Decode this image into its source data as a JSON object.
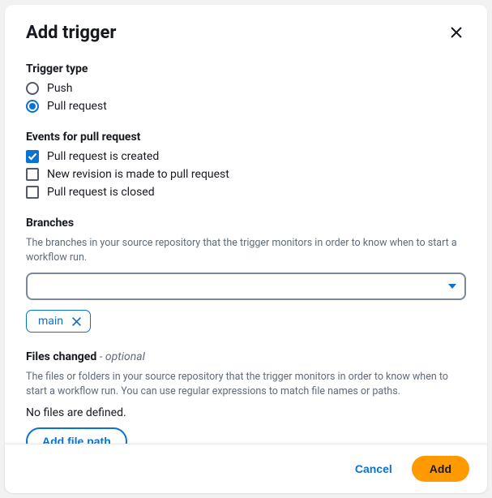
{
  "title": "Add trigger",
  "triggerType": {
    "label": "Trigger type",
    "options": {
      "push": "Push",
      "pullRequest": "Pull request"
    },
    "selected": "pullRequest"
  },
  "events": {
    "label": "Events for pull request",
    "options": {
      "created": {
        "label": "Pull request is created",
        "checked": true
      },
      "revision": {
        "label": "New revision is made to pull request",
        "checked": false
      },
      "closed": {
        "label": "Pull request is closed",
        "checked": false
      }
    }
  },
  "branches": {
    "label": "Branches",
    "help": "The branches in your source repository that the trigger monitors in order to know when to start a workflow run.",
    "tags": [
      "main"
    ]
  },
  "filesChanged": {
    "label": "Files changed",
    "optionalSuffix": " - optional",
    "help": "The files or folders in your source repository that the trigger monitors in order to know when to start a workflow run. You can use regular expressions to match file names or paths.",
    "emptyText": "No files are defined.",
    "addLabel": "Add file path"
  },
  "footer": {
    "cancel": "Cancel",
    "add": "Add"
  }
}
